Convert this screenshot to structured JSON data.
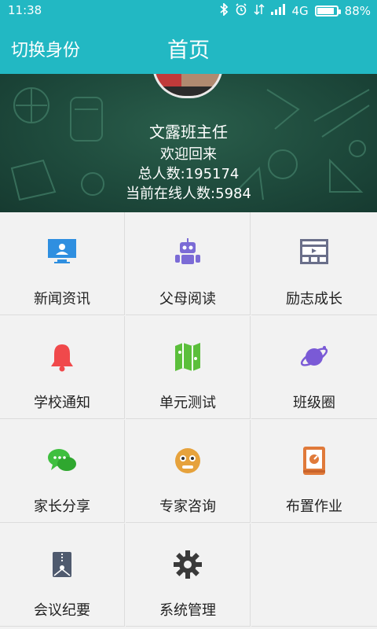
{
  "status_bar": {
    "time": "11:38",
    "network": "4G",
    "battery_text": "88%",
    "battery_level": 0.88
  },
  "header": {
    "switch_label": "切换身份",
    "title": "首页"
  },
  "banner": {
    "name": "文露班主任",
    "welcome": "欢迎回来",
    "total_users": "总人数:195174",
    "online_users": "当前在线人数:5984"
  },
  "menu": [
    {
      "label": "新闻资讯",
      "icon": "monitor-icon",
      "color": "#2f8fe0"
    },
    {
      "label": "父母阅读",
      "icon": "robot-icon",
      "color": "#7b6bd6"
    },
    {
      "label": "励志成长",
      "icon": "video-panel-icon",
      "color": "#6a6f8a"
    },
    {
      "label": "学校通知",
      "icon": "bell-icon",
      "color": "#f0494b"
    },
    {
      "label": "单元测试",
      "icon": "map-icon",
      "color": "#5bbf3b"
    },
    {
      "label": "班级圈",
      "icon": "planet-icon",
      "color": "#7a5ad6"
    },
    {
      "label": "家长分享",
      "icon": "chat-icon",
      "color": "#3fbf3f"
    },
    {
      "label": "专家咨询",
      "icon": "face-icon",
      "color": "#e6a23c"
    },
    {
      "label": "布置作业",
      "icon": "book-icon",
      "color": "#e07a3a"
    },
    {
      "label": "会议纪要",
      "icon": "file-bag-icon",
      "color": "#4f5a6e"
    },
    {
      "label": "系统管理",
      "icon": "gear-icon",
      "color": "#3a3a3a"
    }
  ]
}
